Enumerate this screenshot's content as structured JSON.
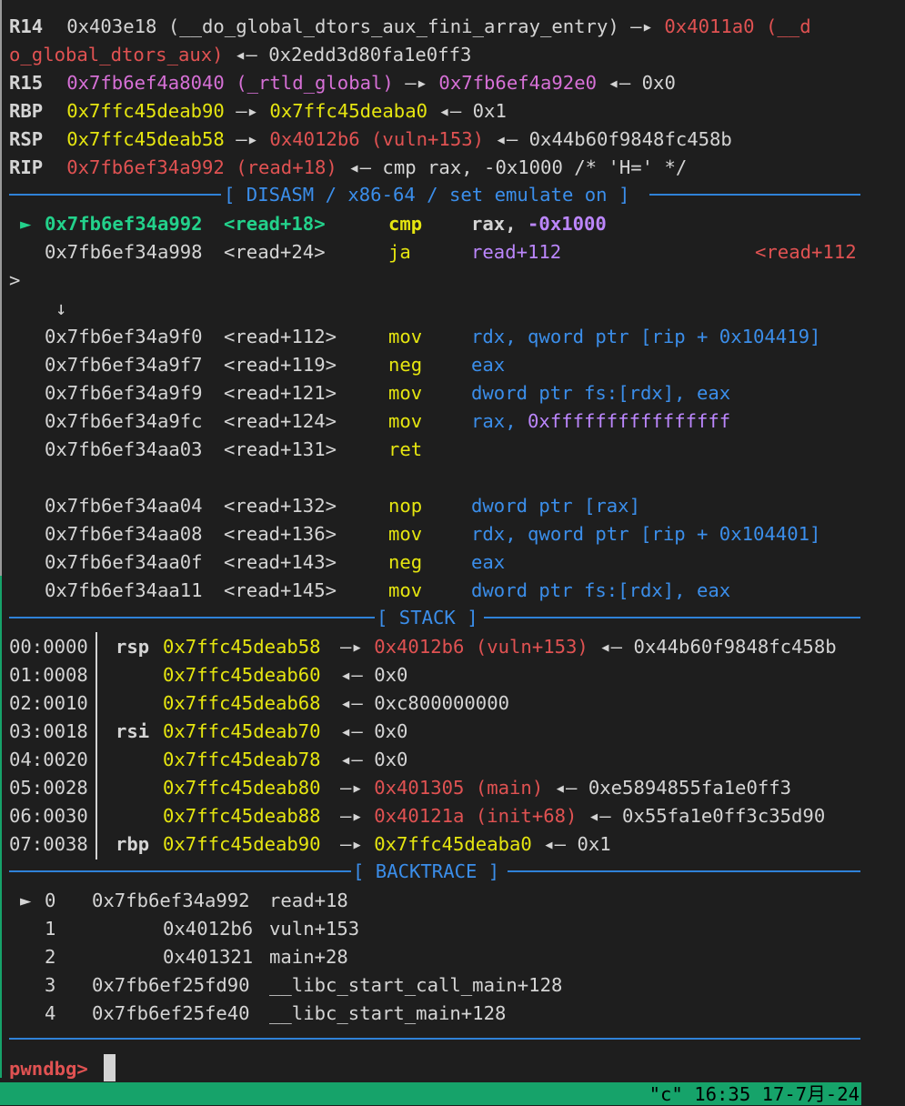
{
  "registers": {
    "r14": {
      "name": "R14",
      "addr": "0x403e18",
      "sym": "(__do_global_dtors_aux_fini_array_entry)",
      "arrow1": "—▸",
      "target": "0x4011a0",
      "target_sym_a": "(__d",
      "target_sym_b": "o_global_dtors_aux)",
      "arrow2": "◂—",
      "val": "0x2edd3d80fa1e0ff3"
    },
    "r15": {
      "name": "R15",
      "addr": "0x7fb6ef4a8040",
      "sym": "(_rtld_global)",
      "arrow1": "—▸",
      "target": "0x7fb6ef4a92e0",
      "arrow2": "◂—",
      "val": "0x0"
    },
    "rbp": {
      "name": "RBP",
      "addr": "0x7ffc45deab90",
      "arrow1": "—▸",
      "target": "0x7ffc45deaba0",
      "arrow2": "◂—",
      "val": "0x1"
    },
    "rsp": {
      "name": "RSP",
      "addr": "0x7ffc45deab58",
      "arrow1": "—▸",
      "target": "0x4012b6",
      "target_sym": "(vuln+153)",
      "arrow2": "◂—",
      "val": "0x44b60f9848fc458b"
    },
    "rip": {
      "name": "RIP",
      "addr": "0x7fb6ef34a992",
      "sym": "(read+18)",
      "arrow2": "◂—",
      "ins": "cmp",
      "op1": "rax,",
      "op2": "-0x1000",
      "comment": "/* 'H=' */"
    }
  },
  "headers": {
    "disasm": "[ DISASM / x86-64 / set emulate on ]",
    "stack": "[ STACK ]",
    "backtrace": "[ BACKTRACE ]"
  },
  "disasm": {
    "current_marker": "►",
    "branch_arrow": "↓",
    "jump_target_a": "<read+112",
    "jump_target_b": ">",
    "rows": [
      {
        "addr": "0x7fb6ef34a992",
        "sym": "<read+18>",
        "mn": "cmp",
        "o1": "rax,",
        "o2": "-0x1000"
      },
      {
        "addr": "0x7fb6ef34a998",
        "sym": "<read+24>",
        "mn": "ja",
        "o1": "read+112"
      },
      {
        "addr": "0x7fb6ef34a9f0",
        "sym": "<read+112>",
        "mn": "mov",
        "o1": "rdx,",
        "o2": "qword ptr",
        "o3": "[rip + 0x104419]"
      },
      {
        "addr": "0x7fb6ef34a9f7",
        "sym": "<read+119>",
        "mn": "neg",
        "o1": "eax"
      },
      {
        "addr": "0x7fb6ef34a9f9",
        "sym": "<read+121>",
        "mn": "mov",
        "o1": "dword ptr fs:[rdx],",
        "o2": "eax"
      },
      {
        "addr": "0x7fb6ef34a9fc",
        "sym": "<read+124>",
        "mn": "mov",
        "o1": "rax,",
        "o2": "0xffffffffffffffff"
      },
      {
        "addr": "0x7fb6ef34aa03",
        "sym": "<read+131>",
        "mn": "ret"
      },
      {
        "addr": "0x7fb6ef34aa04",
        "sym": "<read+132>",
        "mn": "nop",
        "o1": "dword ptr [rax]"
      },
      {
        "addr": "0x7fb6ef34aa08",
        "sym": "<read+136>",
        "mn": "mov",
        "o1": "rdx,",
        "o2": "qword ptr",
        "o3": "[rip + 0x104401]"
      },
      {
        "addr": "0x7fb6ef34aa0f",
        "sym": "<read+143>",
        "mn": "neg",
        "o1": "eax"
      },
      {
        "addr": "0x7fb6ef34aa11",
        "sym": "<read+145>",
        "mn": "mov",
        "o1": "dword ptr fs:[rdx],",
        "o2": "eax"
      }
    ]
  },
  "stack": [
    {
      "off": "00:0000",
      "reg": "rsp",
      "addr": "0x7ffc45deab58",
      "arrow": "—▸",
      "target": "0x4012b6",
      "sym": "(vuln+153)",
      "arrow2": "◂—",
      "val": "0x44b60f9848fc458b"
    },
    {
      "off": "01:0008",
      "reg": "",
      "addr": "0x7ffc45deab60",
      "arrow2": "◂—",
      "val": "0x0"
    },
    {
      "off": "02:0010",
      "reg": "",
      "addr": "0x7ffc45deab68",
      "arrow2": "◂—",
      "val": "0xc800000000"
    },
    {
      "off": "03:0018",
      "reg": "rsi",
      "addr": "0x7ffc45deab70",
      "arrow2": "◂—",
      "val": "0x0"
    },
    {
      "off": "04:0020",
      "reg": "",
      "addr": "0x7ffc45deab78",
      "arrow2": "◂—",
      "val": "0x0"
    },
    {
      "off": "05:0028",
      "reg": "",
      "addr": "0x7ffc45deab80",
      "arrow": "—▸",
      "target": "0x401305",
      "sym": "(main)",
      "arrow2": "◂—",
      "val": "0xe5894855fa1e0ff3"
    },
    {
      "off": "06:0030",
      "reg": "",
      "addr": "0x7ffc45deab88",
      "arrow": "—▸",
      "target": "0x40121a",
      "sym": "(init+68)",
      "arrow2": "◂—",
      "val": "0x55fa1e0ff3c35d90"
    },
    {
      "off": "07:0038",
      "reg": "rbp",
      "addr": "0x7ffc45deab90",
      "arrow": "—▸",
      "target": "0x7ffc45deaba0",
      "arrow2": "◂—",
      "val": "0x1"
    }
  ],
  "backtrace": [
    {
      "marker": "►",
      "idx": "0",
      "addr": "0x7fb6ef34a992",
      "fn": "read+18"
    },
    {
      "marker": "",
      "idx": "1",
      "addr": "0x4012b6",
      "fn": "vuln+153"
    },
    {
      "marker": "",
      "idx": "2",
      "addr": "0x401321",
      "fn": "main+28"
    },
    {
      "marker": "",
      "idx": "3",
      "addr": "0x7fb6ef25fd90",
      "fn": "__libc_start_call_main+128"
    },
    {
      "marker": "",
      "idx": "4",
      "addr": "0x7fb6ef25fe40",
      "fn": "__libc_start_main+128"
    }
  ],
  "prompt": "pwndbg>",
  "status_bar": "\"c\" 16:35 17-7月-24",
  "colors": {
    "background": "#1e1e1e",
    "rule": "#2f82d8",
    "red": "#e05252",
    "magenta": "#d670d6",
    "yellow": "#e5e510",
    "green": "#23d18b",
    "purple": "#bb86fc",
    "blue": "#3b8eea",
    "status_bg": "#16a36a"
  }
}
